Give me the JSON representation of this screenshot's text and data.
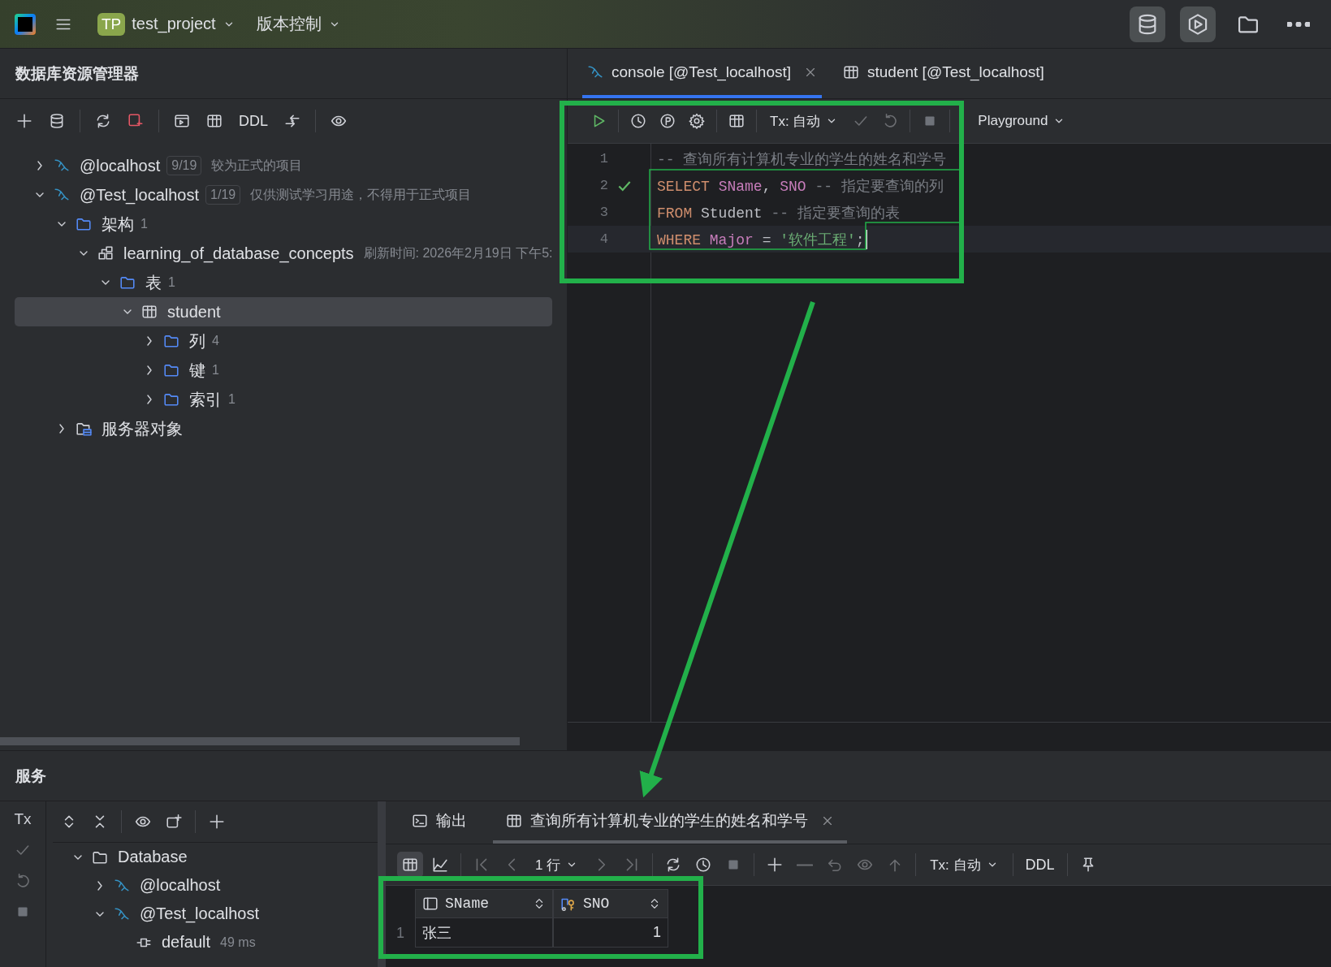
{
  "top_bar": {
    "project_badge": "TP",
    "project": "test_project",
    "vcs": "版本控制"
  },
  "explorer": {
    "title": "数据库资源管理器",
    "toolbar_label": "DDL",
    "tree": [
      {
        "kind": "datasource",
        "label": "@localhost",
        "count": "9/19",
        "note": "较为正式的项目",
        "expanded": false,
        "selected": false
      },
      {
        "kind": "datasource",
        "label": "@Test_localhost",
        "count": "1/19",
        "note": "仅供测试学习用途，不得用于正式项目",
        "expanded": true,
        "selected": false,
        "children": [
          {
            "kind": "folder",
            "label": "架构",
            "count": "1",
            "expanded": true,
            "selected": false,
            "children": [
              {
                "kind": "schema",
                "label": "learning_of_database_concepts",
                "note": "刷新时间: 2026年2月19日 下午5:",
                "expanded": true,
                "selected": false,
                "children": [
                  {
                    "kind": "folder",
                    "label": "表",
                    "count": "1",
                    "expanded": true,
                    "selected": false,
                    "children": [
                      {
                        "kind": "table",
                        "label": "student",
                        "expanded": true,
                        "selected": true,
                        "children": [
                          {
                            "kind": "folder",
                            "label": "列",
                            "count": "4",
                            "expanded": false,
                            "selected": false
                          },
                          {
                            "kind": "folder",
                            "label": "键",
                            "count": "1",
                            "expanded": false,
                            "selected": false
                          },
                          {
                            "kind": "folder",
                            "label": "索引",
                            "count": "1",
                            "expanded": false,
                            "selected": false
                          }
                        ]
                      }
                    ]
                  }
                ]
              }
            ]
          },
          {
            "kind": "server",
            "label": "服务器对象",
            "expanded": false,
            "selected": false
          }
        ]
      }
    ]
  },
  "editor": {
    "tabs": [
      {
        "kind": "console",
        "label": "console [@Test_localhost]",
        "selected": true,
        "closable": true
      },
      {
        "kind": "table",
        "label": "student [@Test_localhost]",
        "selected": false,
        "closable": false
      }
    ],
    "toolbar": {
      "tx": "Tx: 自动",
      "mode": "Playground"
    },
    "lines": [
      {
        "number": "1",
        "current": false,
        "checked": false,
        "tokens": [
          {
            "kind": "comment",
            "text": "-- 查询所有计算机专业的学生的姓名和学号"
          }
        ]
      },
      {
        "number": "2",
        "current": false,
        "checked": true,
        "tokens": [
          {
            "kind": "keyword",
            "text": "SELECT "
          },
          {
            "kind": "column",
            "text": "SName"
          },
          {
            "kind": "plain",
            "text": ", "
          },
          {
            "kind": "column",
            "text": "SNO"
          },
          {
            "kind": "comment",
            "text": " -- 指定要查询的列"
          }
        ]
      },
      {
        "number": "3",
        "current": false,
        "checked": false,
        "tokens": [
          {
            "kind": "keyword",
            "text": "FROM"
          },
          {
            "kind": "plain",
            "text": " Student"
          },
          {
            "kind": "comment",
            "text": " -- 指定要查询的表"
          }
        ]
      },
      {
        "number": "4",
        "current": true,
        "checked": false,
        "tokens": [
          {
            "kind": "keyword",
            "text": "WHERE "
          },
          {
            "kind": "column",
            "text": "Major"
          },
          {
            "kind": "plain",
            "text": " = "
          },
          {
            "kind": "string",
            "text": "'软件工程'"
          },
          {
            "kind": "plain",
            "text": ";"
          }
        ]
      }
    ]
  },
  "services": {
    "title": "服务",
    "tx_label": "Tx",
    "tree": [
      {
        "kind": "folder",
        "label": "Database",
        "expanded": true,
        "children": [
          {
            "kind": "datasource",
            "label": "@localhost",
            "expanded": false
          },
          {
            "kind": "datasource",
            "label": "@Test_localhost",
            "expanded": true,
            "children": [
              {
                "kind": "session",
                "label": "default",
                "note": "49 ms"
              }
            ]
          }
        ]
      }
    ],
    "tabs": [
      {
        "kind": "output",
        "label": "输出",
        "selected": false,
        "closable": false
      },
      {
        "kind": "table",
        "label": "查询所有计算机专业的学生的姓名和学号",
        "selected": true,
        "closable": true
      }
    ],
    "toolbar": {
      "rows": "1 行",
      "tx": "Tx: 自动",
      "ddl": "DDL"
    },
    "grid": {
      "columns": [
        {
          "kind": "column",
          "label": "SName"
        },
        {
          "kind": "key",
          "label": "SNO"
        }
      ],
      "rows": [
        {
          "number": "1",
          "cells": [
            "张三",
            "1"
          ]
        }
      ]
    }
  }
}
